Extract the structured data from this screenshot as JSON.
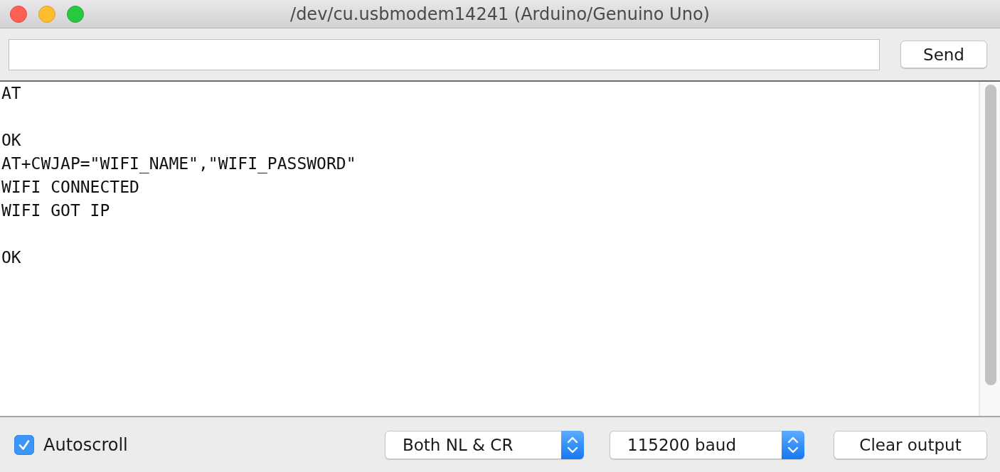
{
  "window": {
    "title": "/dev/cu.usbmodem14241 (Arduino/Genuino Uno)"
  },
  "input_bar": {
    "send_button": "Send"
  },
  "output": {
    "text": "AT\n\nOK\nAT+CWJAP=\"WIFI_NAME\",\"WIFI_PASSWORD\"\nWIFI CONNECTED\nWIFI GOT IP\n\nOK"
  },
  "footer": {
    "autoscroll": {
      "label": "Autoscroll",
      "checked": true
    },
    "line_ending": {
      "value": "Both NL & CR"
    },
    "baud_rate": {
      "value": "115200 baud"
    },
    "clear_button": "Clear output"
  }
}
